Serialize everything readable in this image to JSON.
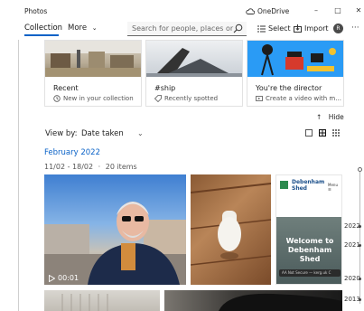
{
  "window": {
    "app_title": "Photos",
    "onedrive_label": "OneDrive",
    "minimize": "–",
    "maximize": "□",
    "close": "✕"
  },
  "toolbar": {
    "collection_tab": "Collection",
    "more_tab": "More",
    "search_placeholder": "Search for people, places or",
    "select_label": "Select",
    "import_label": "Import",
    "avatar_initial": "R",
    "more_options": "···"
  },
  "cards": [
    {
      "title": "Recent",
      "subtitle": "New in your collection",
      "icon": "clock-icon"
    },
    {
      "title": "#ship",
      "subtitle": "Recently spotted",
      "icon": "tag-icon"
    },
    {
      "title": "You're the director",
      "subtitle": "Create a video with m...",
      "icon": "video-create-icon"
    }
  ],
  "hide_label": "Hide",
  "view": {
    "label": "View by:",
    "value": "Date taken"
  },
  "group": {
    "month": "February 2022",
    "range": "11/02 - 18/02",
    "count": "20 items"
  },
  "photos": {
    "video_duration": "00:01",
    "phone_header": "Debenham Shed",
    "phone_menu": "Menu ☰",
    "phone_welcome": "Welcome to Debenham Shed",
    "phone_url": "AA  Not Secure — kerg.uk  C"
  },
  "timeline": {
    "years": [
      "2022",
      "2021",
      "2020",
      "2013"
    ]
  },
  "colors": {
    "accent": "#0a62c7",
    "director_card_bg": "#2a9bf5"
  }
}
